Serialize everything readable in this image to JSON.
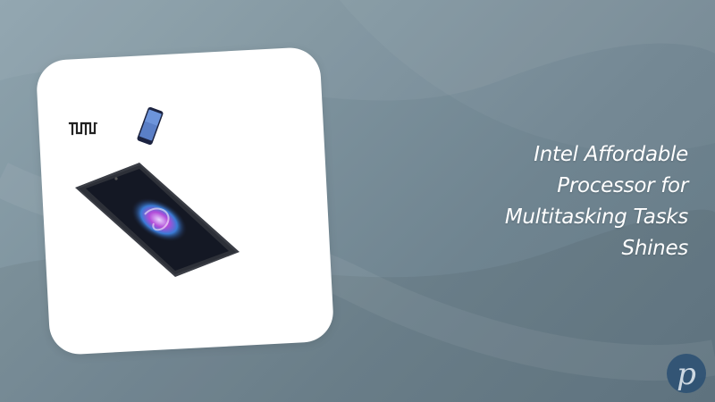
{
  "headline": "Intel Affordable\nProcessor for\nMultitasking Tasks\nShines",
  "badge": {
    "letter": "p"
  },
  "product_image": {
    "brand_logo_text": "TUTU"
  },
  "colors": {
    "background": "#7d929d",
    "card": "#ffffff",
    "headline": "#ffffff",
    "badge": "#2a4f73"
  }
}
